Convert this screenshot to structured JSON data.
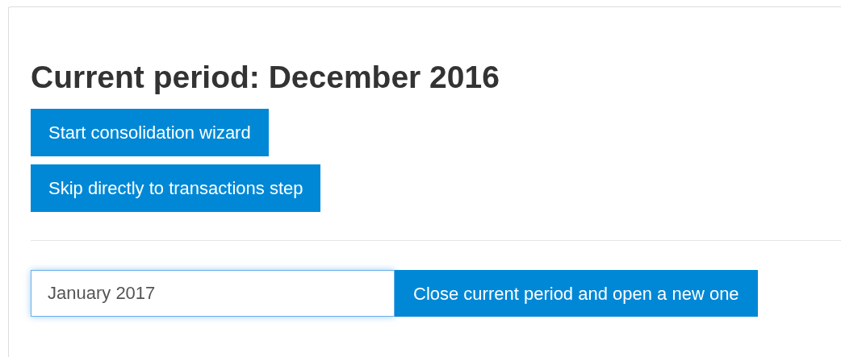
{
  "heading": "Current period: December 2016",
  "actions": [
    {
      "label": "Start consolidation wizard"
    },
    {
      "label": "Skip directly to transactions step"
    }
  ],
  "new_period": {
    "value": "January 2017",
    "focused": true,
    "button": "Close current period and open a new one"
  }
}
